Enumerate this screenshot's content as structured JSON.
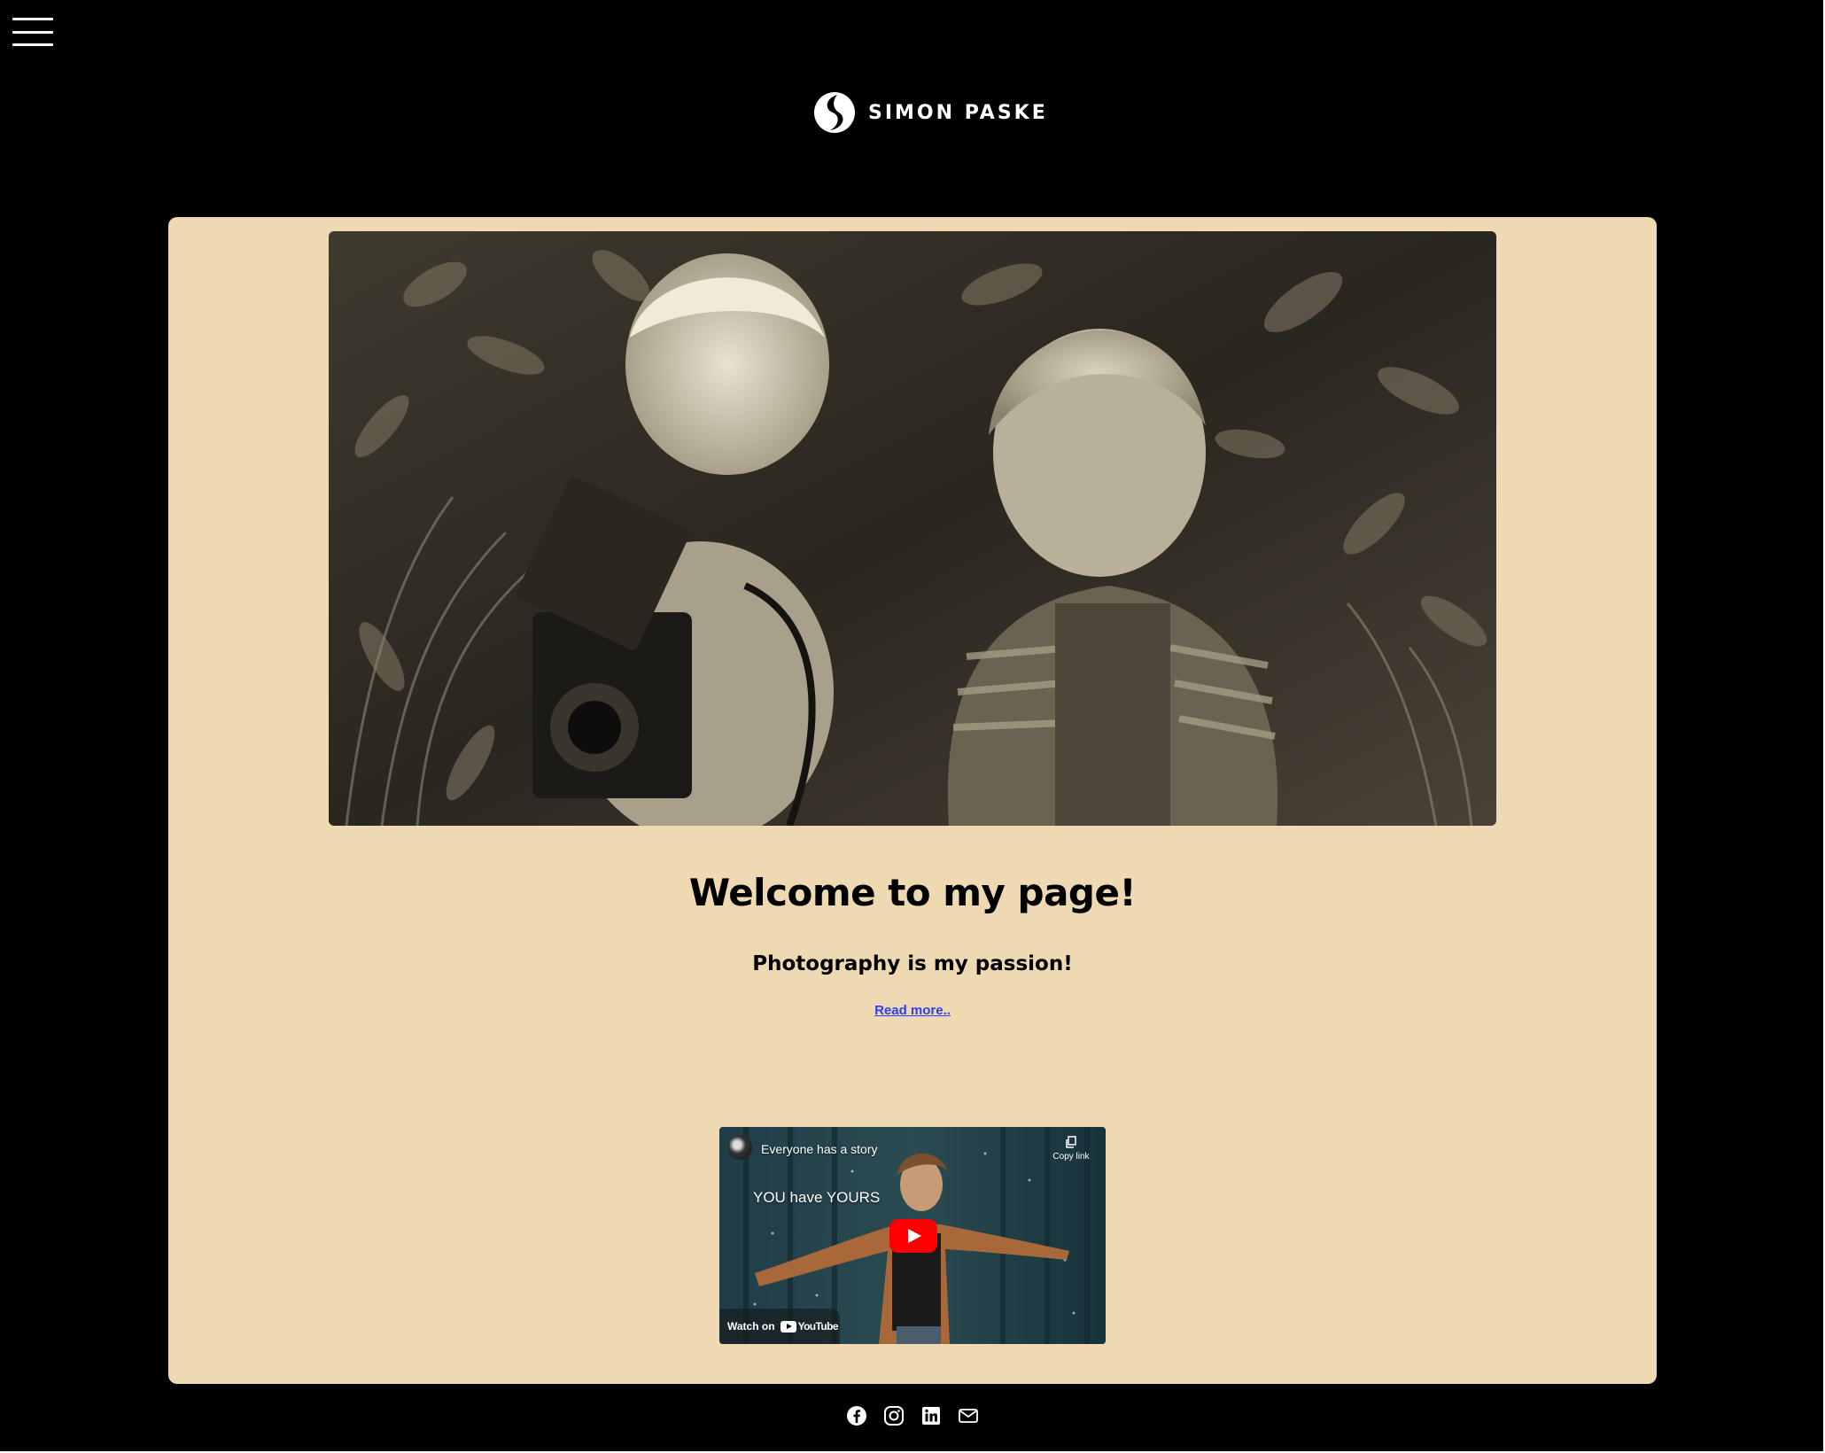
{
  "header": {
    "menu_icon": "hamburger-icon",
    "brand_name": "SIMON PASKE",
    "logo_icon": "sp-logo-icon"
  },
  "main": {
    "hero_image_alt": "",
    "headline": "Welcome to my page!",
    "subheadline": "Photography is my passion!",
    "read_more_label": "Read more.."
  },
  "video": {
    "title": "Everyone has a story",
    "overlay_text": "YOU have YOURS",
    "copy_label": "Copy link",
    "watch_label": "Watch on",
    "youtube_label": "YouTube",
    "play_icon": "play-icon"
  },
  "footer": {
    "socials": [
      {
        "icon": "facebook-icon"
      },
      {
        "icon": "instagram-icon"
      },
      {
        "icon": "linkedin-icon"
      },
      {
        "icon": "mail-icon"
      }
    ]
  },
  "colors": {
    "page_background": "#000000",
    "panel_background": "#eed9b2",
    "link": "#2d3ff5",
    "youtube_red": "#ff0000"
  }
}
